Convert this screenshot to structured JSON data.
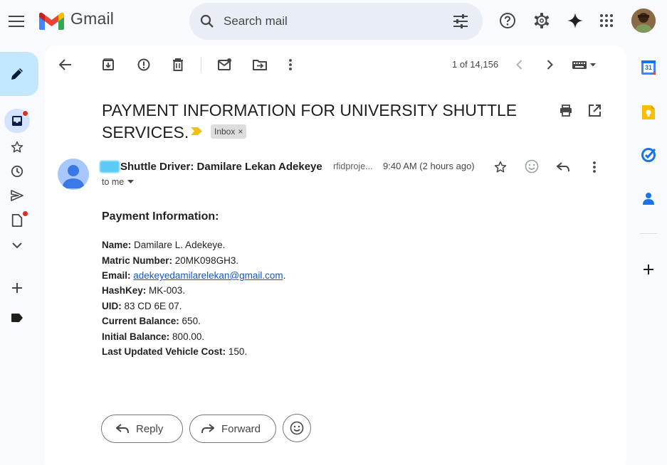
{
  "app": {
    "name": "Gmail"
  },
  "search": {
    "placeholder": "Search mail"
  },
  "toolbar": {
    "counter": "1 of 14,156"
  },
  "email": {
    "subject": "PAYMENT INFORMATION FOR UNIVERSITY SHUTTLE SERVICES.",
    "label": "Inbox",
    "label_close": "×",
    "sender_name": "Shuttle Driver: Damilare Lekan Adekeye",
    "sender_email": "rfidproje...",
    "time": "9:40 AM (2 hours ago)",
    "recipient": "to me",
    "heading": "Payment Information:",
    "fields": [
      {
        "label": "Name:",
        "value": "Damilare L. Adekeye."
      },
      {
        "label": "Matric Number:",
        "value": "20MK098GH3."
      },
      {
        "label": "Email:",
        "value": "adekeyedamilarelekan@gmail.com",
        "suffix": "."
      },
      {
        "label": "HashKey:",
        "value": "MK-003."
      },
      {
        "label": "UID:",
        "value": "83 CD 6E 07."
      },
      {
        "label": "Current Balance:",
        "value": "650."
      },
      {
        "label": "Initial Balance:",
        "value": "800.00."
      },
      {
        "label": "Last Updated Vehicle Cost:",
        "value": "150."
      }
    ]
  },
  "actions": {
    "reply": "Reply",
    "forward": "Forward"
  },
  "side_panel": {
    "calendar_day": "31"
  },
  "colors": {
    "accent": "#0b57d0",
    "compose_bg": "#c2e7ff",
    "link": "#1155cc",
    "badge": "#d93025"
  }
}
